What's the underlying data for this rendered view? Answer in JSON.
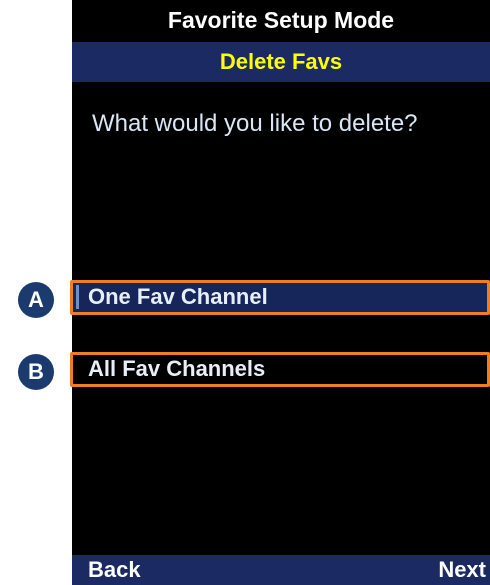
{
  "header": {
    "mode_title": "Favorite Setup Mode",
    "screen_title": "Delete Favs"
  },
  "prompt": "What would you like to delete?",
  "options": [
    {
      "label": "One Fav Channel",
      "marker": "A",
      "selected": true
    },
    {
      "label": "All Fav Channels",
      "marker": "B",
      "selected": false
    }
  ],
  "softkeys": {
    "left": "Back",
    "right": "Next"
  },
  "colors": {
    "screen_background": "#000000",
    "header_bar": "#1b2a63",
    "screen_title_text": "#ffff00",
    "selected_row": "#16255a",
    "annotation_outline": "#f07d1e",
    "annotation_marker": "#1b3a6e"
  }
}
